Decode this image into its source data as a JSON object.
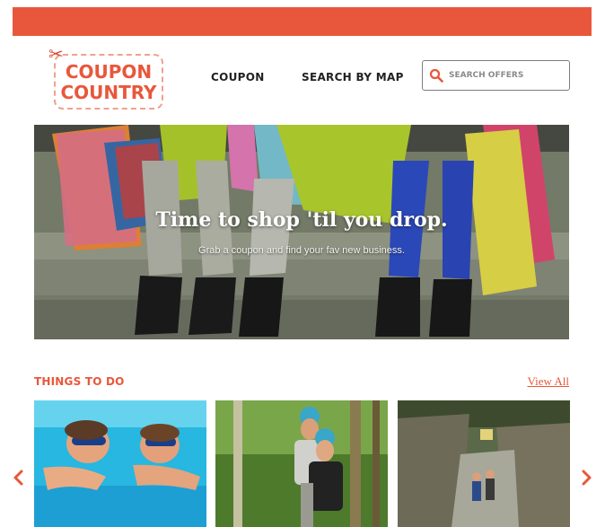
{
  "brand": {
    "logo_line1": "COUPON",
    "logo_line2": "COUNTRY",
    "accent_color": "#e8573b"
  },
  "nav": {
    "items": [
      {
        "label": "COUPON"
      },
      {
        "label": "SEARCH BY MAP"
      }
    ]
  },
  "search": {
    "placeholder": "SEARCH OFFERS",
    "value": "",
    "icon": "search-icon"
  },
  "hero": {
    "title": "Time to shop 'til you drop.",
    "subtitle": "Grab a coupon and find your fav new business."
  },
  "things_to_do": {
    "title": "THINGS TO DO",
    "view_all_label": "View All",
    "cards": [
      {
        "image": "kids swimming underwater with goggles"
      },
      {
        "image": "people ziplining in a forest"
      },
      {
        "image": "hikers in a rocky gorge"
      }
    ],
    "prev_icon": "chevron-left-icon",
    "next_icon": "chevron-right-icon"
  }
}
